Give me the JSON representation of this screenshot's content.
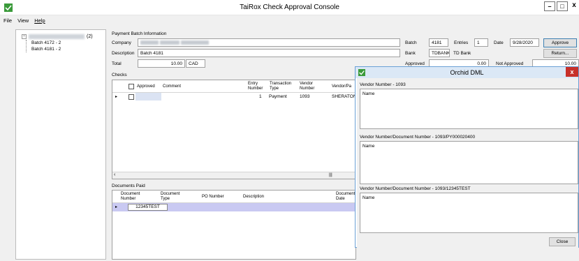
{
  "window": {
    "title": "TaiRox Check Approval Console"
  },
  "menu": [
    {
      "label": "File"
    },
    {
      "label": "View"
    },
    {
      "label": "Help"
    }
  ],
  "tree": {
    "root_count": "(2)",
    "children": [
      "Batch 4172 - 2",
      "Batch 4181 - 2"
    ]
  },
  "batch_info": {
    "group_label": "Payment Batch Information",
    "company_label": "Company",
    "description_label": "Description",
    "description_value": "Batch 4181",
    "total_label": "Total",
    "total_value": "10.00",
    "currency": "CAD",
    "batch_label": "Batch",
    "batch_value": "4181",
    "entries_label": "Entries",
    "entries_value": "1",
    "date_label": "Date",
    "date_value": "9/28/2020",
    "approve_button": "Approve",
    "bank_label": "Bank",
    "bank_code": "TDBANK",
    "bank_name": "TD Bank",
    "return_button": "Return...",
    "approved_label": "Approved",
    "approved_value": "0.00",
    "not_approved_label": "Not Approved",
    "not_approved_value": "10.00"
  },
  "checks": {
    "group_label": "Checks",
    "columns": [
      "Approved",
      "Comment",
      "Entry Number",
      "Transaction Type",
      "Vendor Number",
      "Vendor/Pa"
    ],
    "row": {
      "entry": "1",
      "type": "Payment",
      "vendor": "1093",
      "payee": "SHERATON"
    }
  },
  "documents": {
    "group_label": "Documents Paid",
    "columns": [
      "Document Number",
      "Document Type",
      "PO Number",
      "Description",
      "Document Date"
    ],
    "row": {
      "doc_number": "12345TEST"
    }
  },
  "dialog": {
    "title": "Orchid DML",
    "close_glyph": "x",
    "section1_label": "Vendor Number - 1093",
    "section2_label": "Vendor Number/Document Number - 1093/PY000020400",
    "section3_label": "Vendor Number/Document Number - 1093/12345TEST",
    "grid_header": "Name",
    "close_button": "Close"
  },
  "colors": {
    "dialog_close": "#c7302a",
    "selected_row": "#c9c9f2",
    "accent_border": "#3c7fb1"
  },
  "icons": {
    "app": "green-check-icon",
    "tree_expand": "minus-box-icon"
  }
}
